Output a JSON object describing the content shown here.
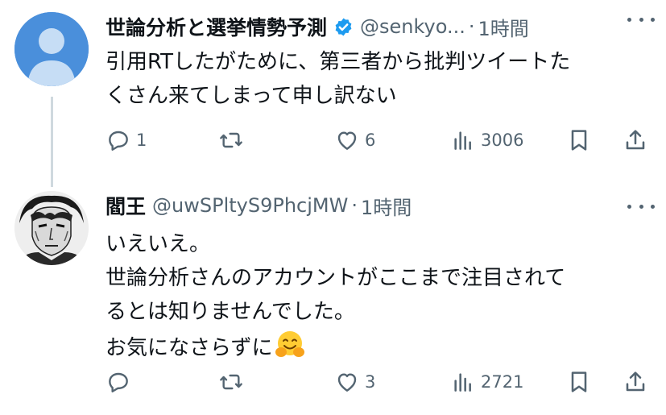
{
  "tweets": [
    {
      "name": "世論分析と選挙情勢予測",
      "handle": "@senkyo...",
      "separator": "·",
      "time": "1時間",
      "verified": true,
      "lines": [
        "引用RTしたがために、第三者から批判ツイートた",
        "くさん来てしまって申し訳ない"
      ],
      "replies": "1",
      "retweets": "",
      "likes": "6",
      "views": "3006",
      "avatar_icon": "default-profile-icon"
    },
    {
      "name": "閻王",
      "handle": "@uwSPltyS9PhcjMW",
      "separator": "·",
      "time": "1時間",
      "verified": false,
      "lines": [
        "いえいえ。",
        "世論分析さんのアカウントがここまで注目されて",
        "るとは知りませんでした。",
        "お気になさらずに"
      ],
      "replies": "",
      "retweets": "",
      "likes": "3",
      "views": "2721",
      "avatar_icon": "manga-portrait-avatar",
      "emoji": "hugging-face-emoji"
    }
  ],
  "colors": {
    "text": "#0f1419",
    "muted": "#536471",
    "verified": "#1d9bf0",
    "thread_line": "#cfd9de",
    "avatar_default": "#4a8fdb"
  }
}
